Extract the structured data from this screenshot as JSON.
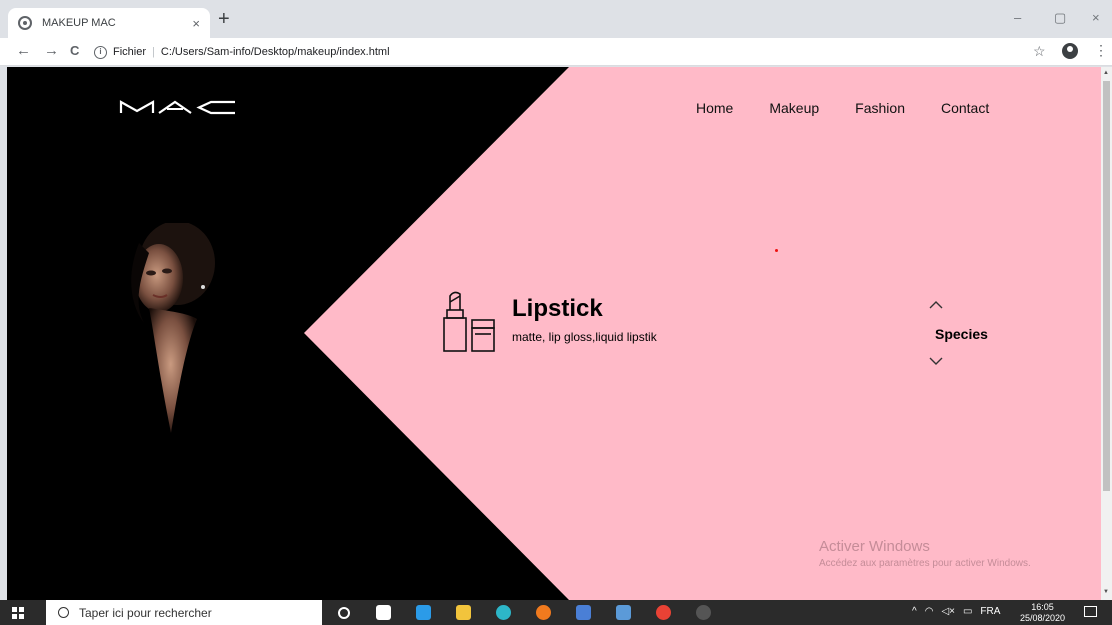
{
  "browser": {
    "tab_title": "MAKEUP MAC",
    "tab_close": "×",
    "new_tab": "+",
    "window_controls": [
      "–",
      "▢",
      "×"
    ],
    "nav": {
      "back": "←",
      "forward": "→",
      "reload": "C"
    },
    "address": {
      "info_icon": "i",
      "label": "Fichier",
      "separator": "|",
      "url": "C:/Users/Sam-info/Desktop/makeup/index.html"
    },
    "bookmark": "☆",
    "menu": "⋮"
  },
  "page": {
    "nav": [
      "Home",
      "Makeup",
      "Fashion",
      "Contact"
    ],
    "product": {
      "title": "Lipstick",
      "subtitle": "matte, lip gloss,liquid lipstik"
    },
    "species": {
      "label": "Species"
    },
    "colors": {
      "pink": "#ffbac8",
      "black": "#000000"
    },
    "watermark": {
      "line1": "Activer Windows",
      "line2": "Accédez aux paramètres pour activer Windows."
    }
  },
  "taskbar": {
    "search_placeholder": "Taper ici pour rechercher",
    "tray": {
      "chevron": "^",
      "lang": "FRA"
    },
    "clock": {
      "time": "16:05",
      "date": "25/08/2020"
    }
  }
}
